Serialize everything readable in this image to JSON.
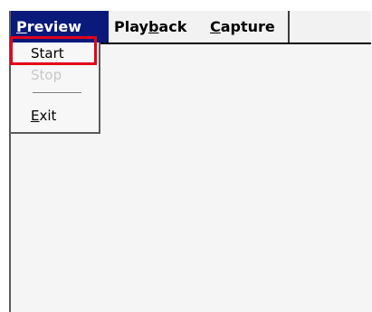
{
  "menubar": {
    "items": [
      {
        "label_pre": "",
        "label_u": "P",
        "label_post": "review",
        "active": true
      },
      {
        "label_pre": "Play",
        "label_u": "b",
        "label_post": "ack",
        "active": false
      },
      {
        "label_pre": "",
        "label_u": "C",
        "label_post": "apture",
        "active": false
      }
    ]
  },
  "dropdown": {
    "items": [
      {
        "label": "Start",
        "enabled": true
      },
      {
        "label": "Stop",
        "enabled": false
      },
      {
        "label_u": "E",
        "label_post": "xit",
        "enabled": true
      }
    ]
  },
  "annotation": {
    "color": "#e3001b"
  },
  "colors": {
    "menu_active_bg": "#0a1a7a",
    "menu_active_text": "#ffffff",
    "disabled_text": "#c7c7c7"
  }
}
